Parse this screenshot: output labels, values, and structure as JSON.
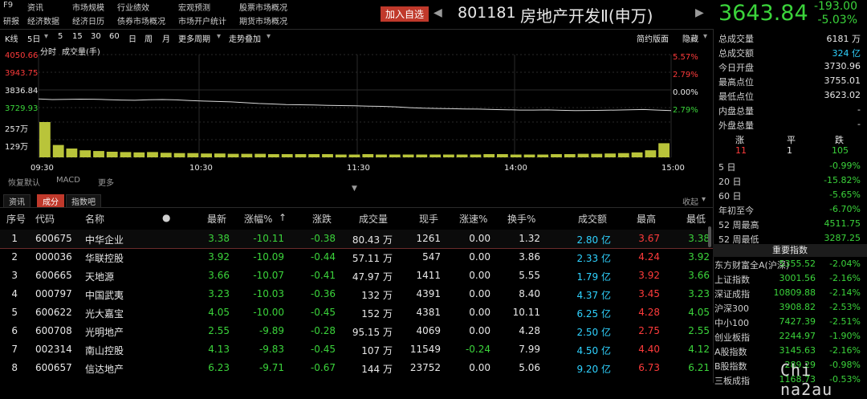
{
  "menus": {
    "top": [
      "F9",
      "资讯",
      "市场规模",
      "行业绩效",
      "宏观预测",
      "股票市场概况"
    ],
    "second": [
      "研报",
      "经济数据",
      "经济日历",
      "债券市场概况",
      "市场开户统计",
      "期货市场概况"
    ]
  },
  "header": {
    "add_fav": "加入自选",
    "code": "801181",
    "name": "房地产开发Ⅱ(申万)",
    "price": "3643.84",
    "change": "-193.00",
    "change_pct": "-5.03%"
  },
  "toolbar": {
    "items": [
      "K线",
      "5日",
      "5",
      "15",
      "30",
      "60",
      "日",
      "周",
      "月",
      "更多周期",
      "走势叠加"
    ],
    "right": [
      "简约版面",
      "隐藏"
    ]
  },
  "chart_data": {
    "type": "line",
    "title": "",
    "sub_labels": [
      "分时",
      "成交量(手)"
    ],
    "y_labels_left": [
      "4050.66",
      "3943.75",
      "3836.84",
      "3729.93",
      "257万",
      "129万"
    ],
    "y_labels_right": [
      "5.57%",
      "2.79%",
      "0.00%",
      "2.79%"
    ],
    "x_labels": [
      "09:30",
      "10:30",
      "11:30",
      "14:00",
      "15:00"
    ],
    "series": [
      {
        "values": [
          3732,
          3728,
          3729,
          3731,
          3730,
          3727,
          3724,
          3722,
          3726,
          3728,
          3725,
          3720,
          3716,
          3713,
          3710,
          3704,
          3698,
          3694,
          3690,
          3688,
          3686,
          3684,
          3682,
          3680,
          3678,
          3676,
          3672,
          3666,
          3662,
          3660,
          3658,
          3656,
          3655,
          3652,
          3650,
          3648,
          3648,
          3649,
          3646,
          3644,
          3645,
          3646,
          3648,
          3650,
          3652,
          3648,
          3644
        ]
      }
    ],
    "volume_values": [
      100,
      35,
      25,
      20,
      18,
      16,
      15,
      14,
      15,
      13,
      12,
      12,
      11,
      11,
      10,
      10,
      10,
      9,
      9,
      9,
      9,
      9,
      8,
      8,
      9,
      8,
      8,
      8,
      8,
      8,
      8,
      8,
      8,
      9,
      9,
      8,
      8,
      8,
      9,
      9,
      10,
      10,
      11,
      12,
      14,
      20,
      40
    ],
    "ylim": [
      3618.0,
      4069.0
    ]
  },
  "indicators": [
    "恢复默认",
    "MACD",
    "更多"
  ],
  "tabs": [
    {
      "label": "资讯",
      "active": false
    },
    {
      "label": "成分",
      "active": true
    },
    {
      "label": "指数吧",
      "active": false
    }
  ],
  "collapse_label": "收起",
  "table": {
    "headers": [
      "序号",
      "代码",
      "名称",
      "●",
      "最新",
      "涨幅%",
      "↑",
      "涨跌",
      "成交量",
      "现手",
      "涨速%",
      "换手%",
      "成交额",
      "最高",
      "最低"
    ],
    "rows": [
      {
        "idx": "1",
        "code": "600675",
        "name": "中华企业",
        "latest": "3.38",
        "pct": "-10.11",
        "chg": "-0.38",
        "vol": "80.43 万",
        "cur": "1261",
        "speed": "0.00",
        "turn": "1.32",
        "amount": "2.80 亿",
        "high": "3.67",
        "low": "3.38"
      },
      {
        "idx": "2",
        "code": "000036",
        "name": "华联控股",
        "latest": "3.92",
        "pct": "-10.09",
        "chg": "-0.44",
        "vol": "57.11 万",
        "cur": "547",
        "speed": "0.00",
        "turn": "3.86",
        "amount": "2.33 亿",
        "high": "4.24",
        "low": "3.92"
      },
      {
        "idx": "3",
        "code": "600665",
        "name": "天地源",
        "latest": "3.66",
        "pct": "-10.07",
        "chg": "-0.41",
        "vol": "47.97 万",
        "cur": "1411",
        "speed": "0.00",
        "turn": "5.55",
        "amount": "1.79 亿",
        "high": "3.92",
        "low": "3.66"
      },
      {
        "idx": "4",
        "code": "000797",
        "name": "中国武夷",
        "latest": "3.23",
        "pct": "-10.03",
        "chg": "-0.36",
        "vol": "132 万",
        "cur": "4391",
        "speed": "0.00",
        "turn": "8.40",
        "amount": "4.37 亿",
        "high": "3.45",
        "low": "3.23"
      },
      {
        "idx": "5",
        "code": "600622",
        "name": "光大嘉宝",
        "latest": "4.05",
        "pct": "-10.00",
        "chg": "-0.45",
        "vol": "152 万",
        "cur": "4381",
        "speed": "0.00",
        "turn": "10.11",
        "amount": "6.25 亿",
        "high": "4.28",
        "low": "4.05"
      },
      {
        "idx": "6",
        "code": "600708",
        "name": "光明地产",
        "latest": "2.55",
        "pct": "-9.89",
        "chg": "-0.28",
        "vol": "95.15 万",
        "cur": "4069",
        "speed": "0.00",
        "turn": "4.28",
        "amount": "2.50 亿",
        "high": "2.75",
        "low": "2.55"
      },
      {
        "idx": "7",
        "code": "002314",
        "name": "南山控股",
        "latest": "4.13",
        "pct": "-9.83",
        "chg": "-0.45",
        "vol": "107 万",
        "cur": "11549",
        "speed": "-0.24",
        "turn": "7.99",
        "amount": "4.50 亿",
        "high": "4.40",
        "low": "4.12"
      },
      {
        "idx": "8",
        "code": "600657",
        "name": "信达地产",
        "latest": "6.23",
        "pct": "-9.71",
        "chg": "-0.67",
        "vol": "144 万",
        "cur": "23752",
        "speed": "0.00",
        "turn": "5.06",
        "amount": "9.20 亿",
        "high": "6.73",
        "low": "6.21"
      }
    ]
  },
  "stats": [
    {
      "label": "总成交量",
      "value": "6181 万",
      "color": "white"
    },
    {
      "label": "总成交额",
      "value": "324 亿",
      "color": "cyan"
    },
    {
      "label": "今日开盘",
      "value": "3730.96",
      "color": "white"
    },
    {
      "label": "最高点位",
      "value": "3755.01",
      "color": "white"
    },
    {
      "label": "最低点位",
      "value": "3623.02",
      "color": "white"
    },
    {
      "label": "内盘总量",
      "value": "-",
      "color": "white"
    },
    {
      "label": "外盘总量",
      "value": "-",
      "color": "white"
    }
  ],
  "breadth": {
    "labels": [
      "涨",
      "平",
      "跌"
    ],
    "values": [
      "11",
      "1",
      "105"
    ]
  },
  "periods": [
    {
      "label": "5 日",
      "value": "-0.99%"
    },
    {
      "label": "20 日",
      "value": "-15.82%"
    },
    {
      "label": "60 日",
      "value": "-5.65%"
    },
    {
      "label": "年初至今",
      "value": "-6.70%"
    },
    {
      "label": "52 周最高",
      "value": "4511.75"
    },
    {
      "label": "52 周最低",
      "value": "3287.25"
    }
  ],
  "indices_title": "重要指数",
  "indices": [
    {
      "name": "东方财富全A(沪深)",
      "price": "5355.52",
      "pct": "-2.04%"
    },
    {
      "name": "上证指数",
      "price": "3001.56",
      "pct": "-2.16%"
    },
    {
      "name": "深证成指",
      "price": "10809.88",
      "pct": "-2.14%"
    },
    {
      "name": "沪深300",
      "price": "3908.82",
      "pct": "-2.53%"
    },
    {
      "name": "中小100",
      "price": "7427.39",
      "pct": "-2.51%"
    },
    {
      "name": "创业板指",
      "price": "2244.97",
      "pct": "-1.90%"
    },
    {
      "name": "A股指数",
      "price": "3145.63",
      "pct": "-2.16%"
    },
    {
      "name": "B股指数",
      "price": "289.29",
      "pct": "-0.98%"
    },
    {
      "name": "三板成指",
      "price": "1168.73",
      "pct": "-0.53%"
    }
  ],
  "watermark": "Chi na2au"
}
